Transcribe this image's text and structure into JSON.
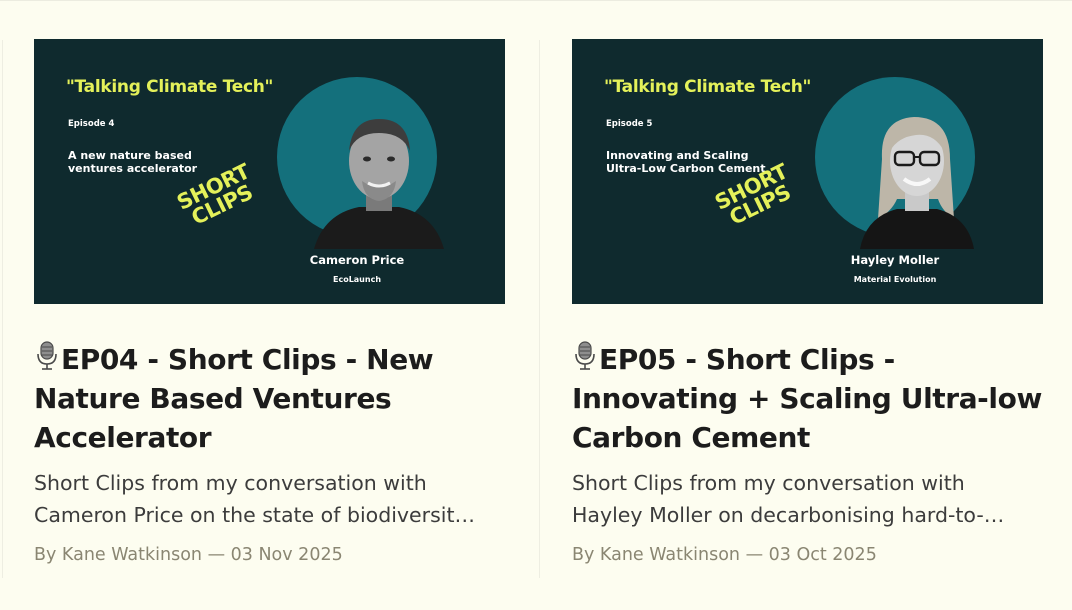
{
  "posts": [
    {
      "thumbnail": {
        "show_title": "\"Talking Climate Tech\"",
        "episode_label": "Episode 4",
        "episode_subtitle": "A new nature based\nventures accelerator",
        "badge_line1": "SHORT",
        "badge_line2": "CLIPS",
        "guest_name": "Cameron Price",
        "guest_org": "EcoLaunch"
      },
      "title": "EP04 - Short Clips - New Nature Based Ventures Accelerator",
      "excerpt_line1": "Short Clips from my conversation with",
      "excerpt_line2": "Cameron Price on the state of biodiversit…",
      "byline": "By Kane Watkinson — 03 Nov 2025"
    },
    {
      "thumbnail": {
        "show_title": "\"Talking Climate Tech\"",
        "episode_label": "Episode 5",
        "episode_subtitle": "Innovating and Scaling\nUltra-Low Carbon Cement",
        "badge_line1": "SHORT",
        "badge_line2": "CLIPS",
        "guest_name": "Hayley Moller",
        "guest_org": "Material Evolution"
      },
      "title": "EP05 - Short Clips - Innovating + Scaling Ultra-low Carbon Cement",
      "excerpt_line1": "Short Clips from my conversation with",
      "excerpt_line2": "Hayley Moller on decarbonising hard-to-…",
      "byline": "By Kane Watkinson — 03 Oct 2025"
    }
  ],
  "colors": {
    "thumbnail_bg": "#0f2a2e",
    "accent_yellow": "#e4f15a",
    "circle_teal": "#14707c",
    "page_bg": "#fdfdf0"
  },
  "icons": {
    "title_prefix": "microphone-icon"
  }
}
